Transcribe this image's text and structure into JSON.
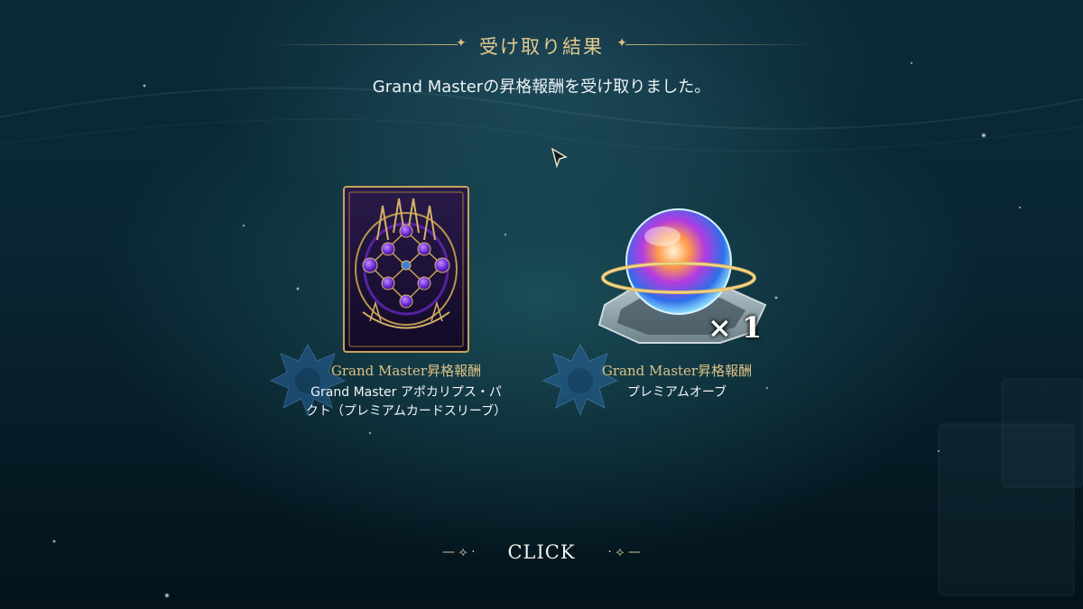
{
  "header": {
    "title": "受け取り結果",
    "subtitle": "Grand Masterの昇格報酬を受け取りました。",
    "ornament": "✦"
  },
  "rewards": [
    {
      "label": "Grand Master昇格報酬",
      "name_line1": "Grand Master アポカリプス・パ",
      "name_line2": "クト（プレミアムカードスリーブ）",
      "icon": "card-sleeve-icon"
    },
    {
      "label": "Grand Master昇格報酬",
      "name_line1": "プレミアムオーブ",
      "quantity": "× 1",
      "icon": "premium-orb-icon"
    }
  ],
  "footer": {
    "click_label": "CLICK",
    "ornament": "⟡"
  },
  "colors": {
    "gold": "#dcc287",
    "background": "#0a2633",
    "text": "#f2f5f7"
  }
}
